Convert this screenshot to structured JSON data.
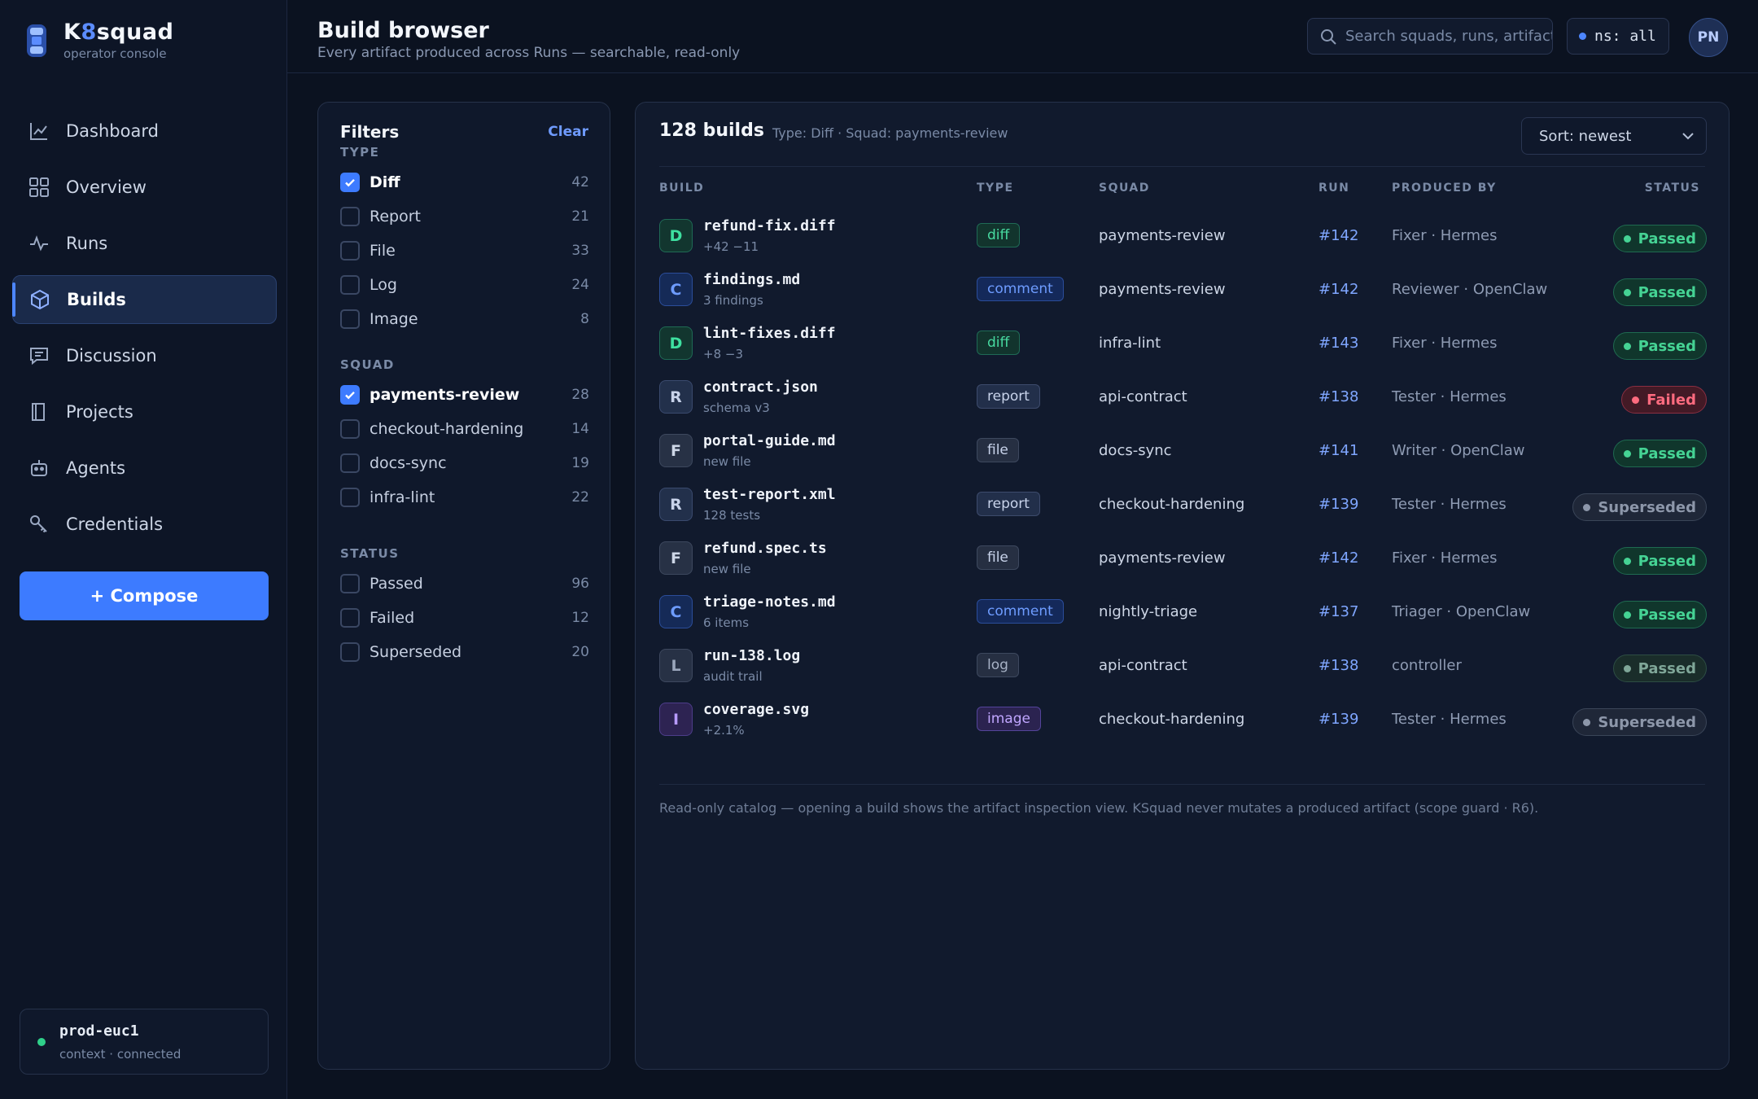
{
  "brand": {
    "name_prefix": "K",
    "name_accent": "8",
    "name_suffix": "squad",
    "subtitle": "operator console"
  },
  "nav": [
    {
      "label": "Dashboard",
      "icon": "chart-line-icon",
      "active": false
    },
    {
      "label": "Overview",
      "icon": "grid-icon",
      "active": false
    },
    {
      "label": "Runs",
      "icon": "pulse-icon",
      "active": false
    },
    {
      "label": "Builds",
      "icon": "cube-icon",
      "active": true
    },
    {
      "label": "Discussion",
      "icon": "chat-icon",
      "active": false
    },
    {
      "label": "Projects",
      "icon": "book-icon",
      "active": false
    },
    {
      "label": "Agents",
      "icon": "robot-icon",
      "active": false
    },
    {
      "label": "Credentials",
      "icon": "key-icon",
      "active": false
    }
  ],
  "compose_label": "+ Compose",
  "context": {
    "name": "prod-euc1",
    "status": "context · connected"
  },
  "header": {
    "title": "Build browser",
    "subtitle": "Every artifact produced across Runs — searchable, read-only",
    "search_placeholder": "Search squads, runs, artifacts…",
    "namespace": "ns: all",
    "avatar": "PN"
  },
  "filters": {
    "title": "Filters",
    "clear": "Clear",
    "sections": [
      {
        "title": "TYPE",
        "options": [
          {
            "label": "Diff",
            "count": "42",
            "checked": true
          },
          {
            "label": "Report",
            "count": "21",
            "checked": false
          },
          {
            "label": "File",
            "count": "33",
            "checked": false
          },
          {
            "label": "Log",
            "count": "24",
            "checked": false
          },
          {
            "label": "Image",
            "count": "8",
            "checked": false
          }
        ]
      },
      {
        "title": "SQUAD",
        "options": [
          {
            "label": "payments-review",
            "count": "28",
            "checked": true
          },
          {
            "label": "checkout-hardening",
            "count": "14",
            "checked": false
          },
          {
            "label": "docs-sync",
            "count": "19",
            "checked": false
          },
          {
            "label": "infra-lint",
            "count": "22",
            "checked": false
          }
        ]
      },
      {
        "title": "STATUS",
        "options": [
          {
            "label": "Passed",
            "count": "96",
            "checked": false
          },
          {
            "label": "Failed",
            "count": "12",
            "checked": false
          },
          {
            "label": "Superseded",
            "count": "20",
            "checked": false
          }
        ]
      }
    ]
  },
  "results": {
    "count": "128 builds",
    "active_filters": "Type: Diff · Squad: payments-review",
    "sort": "Sort: newest",
    "columns": {
      "build": "BUILD",
      "type": "TYPE",
      "squad": "SQUAD",
      "run": "RUN",
      "produced_by": "PRODUCED BY",
      "status": "STATUS"
    },
    "rows": [
      {
        "badge": "D",
        "name": "refund-fix.diff",
        "sub": "+42 −11",
        "type": "diff",
        "squad": "payments-review",
        "run": "#142",
        "by": "Fixer · Hermes",
        "status": "Passed",
        "status_kind": "passed"
      },
      {
        "badge": "C",
        "name": "findings.md",
        "sub": "3 findings",
        "type": "comment",
        "squad": "payments-review",
        "run": "#142",
        "by": "Reviewer · OpenClaw",
        "status": "Passed",
        "status_kind": "passed"
      },
      {
        "badge": "D",
        "name": "lint-fixes.diff",
        "sub": "+8 −3",
        "type": "diff",
        "squad": "infra-lint",
        "run": "#143",
        "by": "Fixer · Hermes",
        "status": "Passed",
        "status_kind": "passed"
      },
      {
        "badge": "R",
        "name": "contract.json",
        "sub": "schema v3",
        "type": "report",
        "squad": "api-contract",
        "run": "#138",
        "by": "Tester · Hermes",
        "status": "Failed",
        "status_kind": "failed"
      },
      {
        "badge": "F",
        "name": "portal-guide.md",
        "sub": "new file",
        "type": "file",
        "squad": "docs-sync",
        "run": "#141",
        "by": "Writer · OpenClaw",
        "status": "Passed",
        "status_kind": "passed"
      },
      {
        "badge": "R",
        "name": "test-report.xml",
        "sub": "128 tests",
        "type": "report",
        "squad": "checkout-hardening",
        "run": "#139",
        "by": "Tester · Hermes",
        "status": "Superseded",
        "status_kind": "superseded"
      },
      {
        "badge": "F",
        "name": "refund.spec.ts",
        "sub": "new file",
        "type": "file",
        "squad": "payments-review",
        "run": "#142",
        "by": "Fixer · Hermes",
        "status": "Passed",
        "status_kind": "passed"
      },
      {
        "badge": "C",
        "name": "triage-notes.md",
        "sub": "6 items",
        "type": "comment",
        "squad": "nightly-triage",
        "run": "#137",
        "by": "Triager · OpenClaw",
        "status": "Passed",
        "status_kind": "passed"
      },
      {
        "badge": "L",
        "name": "run-138.log",
        "sub": "audit trail",
        "type": "log",
        "squad": "api-contract",
        "run": "#138",
        "by": "controller",
        "status": "Passed",
        "status_kind": "passed-muted"
      },
      {
        "badge": "I",
        "name": "coverage.svg",
        "sub": "+2.1%",
        "type": "image",
        "squad": "checkout-hardening",
        "run": "#139",
        "by": "Tester · Hermes",
        "status": "Superseded",
        "status_kind": "superseded"
      }
    ],
    "footnote": "Read-only catalog — opening a build shows the artifact inspection view. KSquad never mutates a produced artifact (scope guard · R6)."
  }
}
